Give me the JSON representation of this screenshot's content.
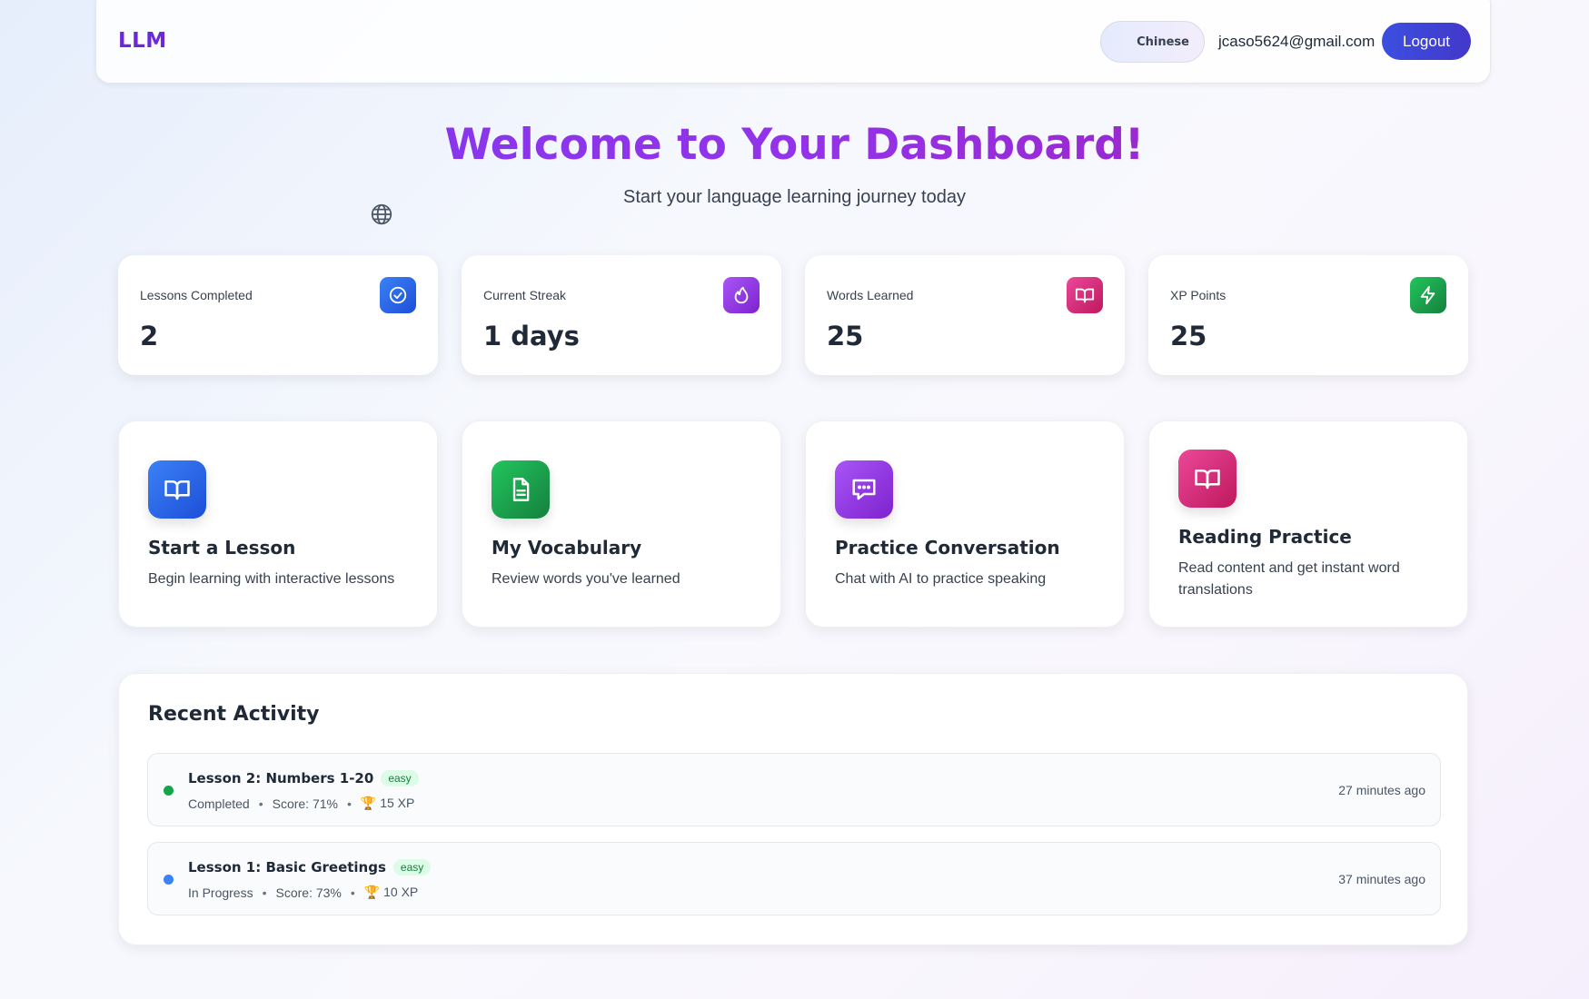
{
  "header": {
    "logo": "LLM",
    "language": "Chinese",
    "email": "jcaso5624@gmail.com",
    "logout_label": "Logout"
  },
  "hero": {
    "title": "Welcome to Your Dashboard!",
    "subtitle": "Start your language learning journey today"
  },
  "stats": [
    {
      "label": "Lessons Completed",
      "value": "2",
      "icon": "check-circle-icon",
      "color": "#2563eb"
    },
    {
      "label": "Current Streak",
      "value": "1 days",
      "icon": "flame-icon",
      "color": "#9333ea"
    },
    {
      "label": "Words Learned",
      "value": "25",
      "icon": "book-open-icon",
      "color": "#db2777"
    },
    {
      "label": "XP Points",
      "value": "25",
      "icon": "lightning-icon",
      "color": "#16a34a"
    }
  ],
  "features": [
    {
      "title": "Start a Lesson",
      "description": "Begin learning with interactive lessons",
      "icon": "book-open-icon",
      "color": "#2563eb"
    },
    {
      "title": "My Vocabulary",
      "description": "Review words you've learned",
      "icon": "document-icon",
      "color": "#16a34a"
    },
    {
      "title": "Practice Conversation",
      "description": "Chat with AI to practice speaking",
      "icon": "chat-icon",
      "color": "#9333ea"
    },
    {
      "title": "Reading Practice",
      "description": "Read content and get instant word translations",
      "icon": "book-open-icon",
      "color": "#db2777"
    }
  ],
  "activity": {
    "title": "Recent Activity",
    "items": [
      {
        "name": "Lesson 2: Numbers 1-20",
        "difficulty": "easy",
        "status": "Completed",
        "score": "Score: 71%",
        "xp": "15 XP",
        "time": "27 minutes ago",
        "dot_color": "#16a34a"
      },
      {
        "name": "Lesson 1: Basic Greetings",
        "difficulty": "easy",
        "status": "In Progress",
        "score": "Score: 73%",
        "xp": "10 XP",
        "time": "37 minutes ago",
        "dot_color": "#3b82f6"
      }
    ]
  }
}
